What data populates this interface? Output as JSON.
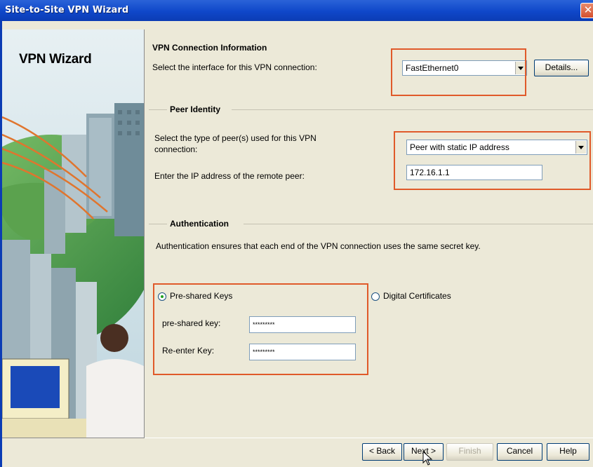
{
  "window": {
    "title": "Site-to-Site VPN Wizard",
    "close_glyph": "✕"
  },
  "left_panel": {
    "heading": "VPN Wizard",
    "illustration_icon": "vpn-wizard-illustration"
  },
  "connection": {
    "heading": "VPN Connection Information",
    "interface_label": "Select the interface for this VPN connection:",
    "interface_value": "FastEthernet0",
    "details_button": "Details..."
  },
  "peer": {
    "group_label": "Peer Identity",
    "type_label_line1": "Select the type of peer(s) used for this VPN",
    "type_label_line2": "connection:",
    "type_value": "Peer with static IP address",
    "ip_label": "Enter the IP address of the remote peer:",
    "ip_value": "172.16.1.1"
  },
  "auth": {
    "group_label": "Authentication",
    "description": "Authentication ensures that each end of the VPN connection uses the same secret key.",
    "pre_shared_radio": "Pre-shared Keys",
    "digital_cert_radio": "Digital Certificates",
    "key_label": "pre-shared key:",
    "key_value": "*********",
    "reenter_label": "Re-enter Key:",
    "reenter_value": "*********",
    "selected": "Pre-shared Keys"
  },
  "footer": {
    "back": "< Back",
    "next": "Next >",
    "finish": "Finish",
    "cancel": "Cancel",
    "help": "Help"
  },
  "colors": {
    "titlebar": "#0F47C9",
    "highlight": "#E05A2A",
    "dialog_bg": "#ECE9D8"
  }
}
